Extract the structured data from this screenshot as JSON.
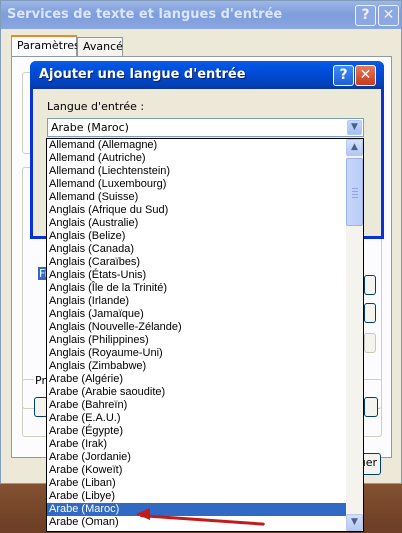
{
  "outer_window": {
    "title": "Services de texte et langues d'entrée",
    "help_glyph": "?",
    "close_glyph": "✕",
    "tabs": [
      {
        "label": "Paramètres",
        "active": true
      },
      {
        "label": "Avancé",
        "active": false
      }
    ],
    "partial_labels": {
      "f": "Fi",
      "pre": "Pré",
      "ajouter_suffix": "uer"
    }
  },
  "dialog": {
    "title": "Ajouter une langue d'entrée",
    "help_glyph": "?",
    "close_glyph": "✕",
    "input_language_label": "Langue d'entrée :",
    "selected_language": "Arabe (Maroc)",
    "dropdown_glyph": "▼"
  },
  "dropdown": {
    "items": [
      "Allemand (Allemagne)",
      "Allemand (Autriche)",
      "Allemand (Liechtenstein)",
      "Allemand (Luxembourg)",
      "Allemand (Suisse)",
      "Anglais (Afrique du Sud)",
      "Anglais (Australie)",
      "Anglais (Belize)",
      "Anglais (Canada)",
      "Anglais (Caraïbes)",
      "Anglais (États-Unis)",
      "Anglais (Île de la Trinité)",
      "Anglais (Irlande)",
      "Anglais (Jamaïque)",
      "Anglais (Nouvelle-Zélande)",
      "Anglais (Philippines)",
      "Anglais (Royaume-Uni)",
      "Anglais (Zimbabwe)",
      "Arabe (Algérie)",
      "Arabe (Arabie saoudite)",
      "Arabe (Bahreïn)",
      "Arabe (E.A.U.)",
      "Arabe (Égypte)",
      "Arabe (Irak)",
      "Arabe (Jordanie)",
      "Arabe (Koweït)",
      "Arabe (Liban)",
      "Arabe (Libye)",
      "Arabe (Maroc)",
      "Arabe (Oman)"
    ],
    "selected_index": 28,
    "scroll_up_glyph": "▲",
    "scroll_down_glyph": "▼"
  },
  "colors": {
    "selection": "#316ac5",
    "active_title": "#0054e3",
    "annotation_arrow": "#c11c1c"
  }
}
